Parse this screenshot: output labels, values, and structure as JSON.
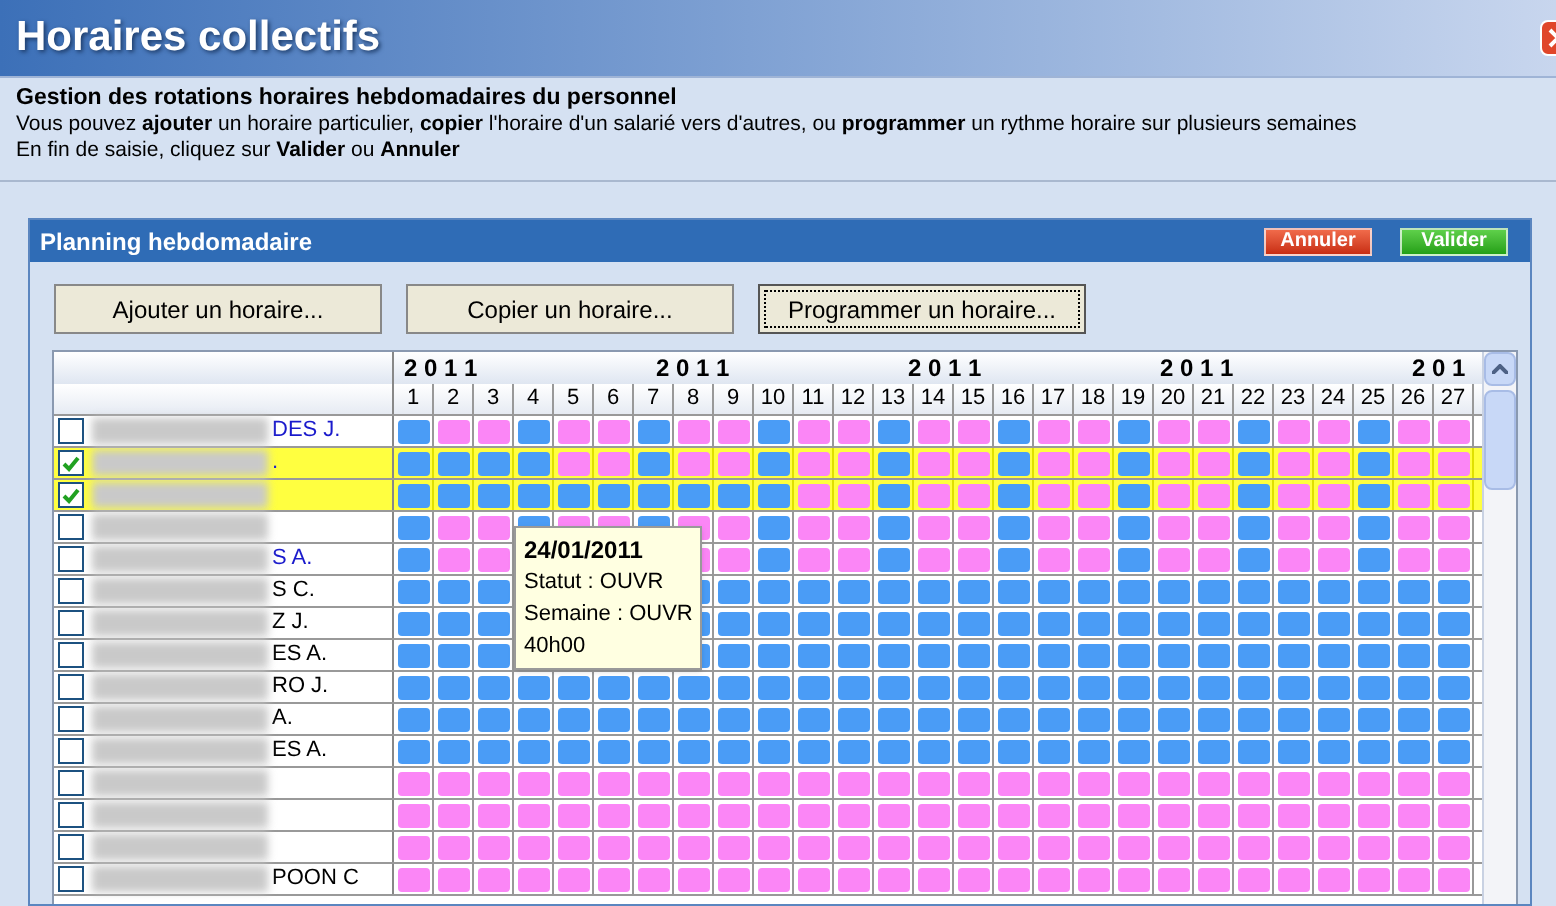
{
  "window": {
    "title": "Horaires collectifs"
  },
  "intro": {
    "heading": "Gestion des rotations horaires hebdomadaires du personnel",
    "lines": [
      "Vous pouvez **ajouter** un horaire particulier, **copier** l'horaire d'un salarié vers d'autres, ou **programmer** un rythme horaire sur plusieurs semaines",
      "En fin de saisie, cliquez sur **Valider** ou **Annuler**"
    ]
  },
  "panel": {
    "title": "Planning hebdomadaire",
    "header_buttons": [
      {
        "label": "Annuler",
        "kind": "cancel"
      },
      {
        "label": "Valider",
        "kind": "ok"
      }
    ],
    "buttons": [
      {
        "label": "Ajouter un horaire...",
        "focused": false
      },
      {
        "label": "Copier un horaire...",
        "focused": false
      },
      {
        "label": "Programmer un horaire...",
        "focused": true
      }
    ]
  },
  "grid": {
    "years": [
      "2 0 1 1",
      "2 0 1 1",
      "2 0 1 1",
      "2 0 1 1",
      "2 0 1"
    ],
    "weeks": [
      "1",
      "2",
      "3",
      "4",
      "5",
      "6",
      "7",
      "8",
      "9",
      "10",
      "11",
      "12",
      "13",
      "14",
      "15",
      "16",
      "17",
      "18",
      "19",
      "20",
      "21",
      "22",
      "23",
      "24",
      "25",
      "26",
      "27"
    ],
    "rows": [
      {
        "name": "DES J.",
        "checked": false,
        "highlighted": false,
        "linked": true,
        "cells": [
          {
            "color": "#4a9cf6"
          },
          {
            "color": "#fb86f6"
          },
          {
            "color": "#fb86f6"
          },
          {
            "color": "#4a9cf6"
          },
          {
            "color": "#fb86f6"
          },
          {
            "color": "#fb86f6"
          },
          {
            "color": "#4a9cf6"
          },
          {
            "color": "#fb86f6"
          },
          {
            "color": "#fb86f6"
          },
          {
            "color": "#4a9cf6"
          },
          {
            "color": "#fb86f6"
          },
          {
            "color": "#fb86f6"
          },
          {
            "color": "#4a9cf6"
          },
          {
            "color": "#fb86f6"
          },
          {
            "color": "#fb86f6"
          },
          {
            "color": "#4a9cf6"
          },
          {
            "color": "#fb86f6"
          },
          {
            "color": "#fb86f6"
          },
          {
            "color": "#4a9cf6"
          },
          {
            "color": "#fb86f6"
          },
          {
            "color": "#fb86f6"
          },
          {
            "color": "#4a9cf6"
          },
          {
            "color": "#fb86f6"
          },
          {
            "color": "#fb86f6"
          },
          {
            "color": "#4a9cf6"
          },
          {
            "color": "#fb86f6"
          },
          {
            "color": "#fb86f6"
          }
        ]
      },
      {
        "name": ".",
        "checked": true,
        "highlighted": true,
        "linked": true,
        "cells": [
          {
            "color": "#4a9cf6"
          },
          {
            "color": "#4a9cf6"
          },
          {
            "color": "#4a9cf6"
          },
          {
            "color": "#4a9cf6"
          },
          {
            "color": "#fb86f6"
          },
          {
            "color": "#fb86f6"
          },
          {
            "color": "#4a9cf6"
          },
          {
            "color": "#fb86f6"
          },
          {
            "color": "#fb86f6"
          },
          {
            "color": "#4a9cf6"
          },
          {
            "color": "#fb86f6"
          },
          {
            "color": "#fb86f6"
          },
          {
            "color": "#4a9cf6"
          },
          {
            "color": "#fb86f6"
          },
          {
            "color": "#fb86f6"
          },
          {
            "color": "#4a9cf6"
          },
          {
            "color": "#fb86f6"
          },
          {
            "color": "#fb86f6"
          },
          {
            "color": "#4a9cf6"
          },
          {
            "color": "#fb86f6"
          },
          {
            "color": "#fb86f6"
          },
          {
            "color": "#4a9cf6"
          },
          {
            "color": "#fb86f6"
          },
          {
            "color": "#fb86f6"
          },
          {
            "color": "#4a9cf6"
          },
          {
            "color": "#fb86f6"
          },
          {
            "color": "#fb86f6"
          }
        ]
      },
      {
        "checked": true,
        "highlighted": true,
        "cells": [
          {
            "color": "#4a9cf6"
          },
          {
            "color": "#4a9cf6"
          },
          {
            "color": "#4a9cf6"
          },
          {
            "color": "#4a9cf6"
          },
          {
            "color": "#4a9cf6"
          },
          {
            "color": "#4a9cf6"
          },
          {
            "color": "#4a9cf6"
          },
          {
            "color": "#4a9cf6"
          },
          {
            "color": "#4a9cf6"
          },
          {
            "color": "#4a9cf6"
          },
          {
            "color": "#fb86f6"
          },
          {
            "color": "#fb86f6"
          },
          {
            "color": "#4a9cf6"
          },
          {
            "color": "#fb86f6"
          },
          {
            "color": "#fb86f6"
          },
          {
            "color": "#4a9cf6"
          },
          {
            "color": "#fb86f6"
          },
          {
            "color": "#fb86f6"
          },
          {
            "color": "#4a9cf6"
          },
          {
            "color": "#fb86f6"
          },
          {
            "color": "#fb86f6"
          },
          {
            "color": "#4a9cf6"
          },
          {
            "color": "#fb86f6"
          },
          {
            "color": "#fb86f6"
          },
          {
            "color": "#4a9cf6"
          },
          {
            "color": "#fb86f6"
          },
          {
            "color": "#fb86f6"
          }
        ]
      },
      {
        "checked": false,
        "highlighted": false,
        "cells": [
          {
            "color": "#4a9cf6"
          },
          {
            "color": "#fb86f6"
          },
          {
            "color": "#fb86f6"
          },
          {
            "color": "#4a9cf6"
          },
          {
            "color": "#fb86f6"
          },
          {
            "color": "#fb86f6"
          },
          {
            "color": "#4a9cf6"
          },
          {
            "color": "#fb86f6"
          },
          {
            "color": "#fb86f6"
          },
          {
            "color": "#4a9cf6"
          },
          {
            "color": "#fb86f6"
          },
          {
            "color": "#fb86f6"
          },
          {
            "color": "#4a9cf6"
          },
          {
            "color": "#fb86f6"
          },
          {
            "color": "#fb86f6"
          },
          {
            "color": "#4a9cf6"
          },
          {
            "color": "#fb86f6"
          },
          {
            "color": "#fb86f6"
          },
          {
            "color": "#4a9cf6"
          },
          {
            "color": "#fb86f6"
          },
          {
            "color": "#fb86f6"
          },
          {
            "color": "#4a9cf6"
          },
          {
            "color": "#fb86f6"
          },
          {
            "color": "#fb86f6"
          },
          {
            "color": "#4a9cf6"
          },
          {
            "color": "#fb86f6"
          },
          {
            "color": "#fb86f6"
          }
        ]
      },
      {
        "name": "S A.",
        "checked": false,
        "highlighted": false,
        "linked": true,
        "cells": [
          {
            "color": "#4a9cf6"
          },
          {
            "color": "#fb86f6"
          },
          {
            "color": "#fb86f6"
          },
          null,
          null,
          null,
          null,
          {
            "color": "#fb86f6"
          },
          {
            "color": "#fb86f6"
          },
          {
            "color": "#4a9cf6"
          },
          {
            "color": "#fb86f6"
          },
          {
            "color": "#fb86f6"
          },
          {
            "color": "#4a9cf6"
          },
          {
            "color": "#fb86f6"
          },
          {
            "color": "#fb86f6"
          },
          {
            "color": "#4a9cf6"
          },
          {
            "color": "#fb86f6"
          },
          {
            "color": "#fb86f6"
          },
          {
            "color": "#4a9cf6"
          },
          {
            "color": "#fb86f6"
          },
          {
            "color": "#fb86f6"
          },
          {
            "color": "#4a9cf6"
          },
          {
            "color": "#fb86f6"
          },
          {
            "color": "#fb86f6"
          },
          {
            "color": "#4a9cf6"
          },
          {
            "color": "#fb86f6"
          },
          {
            "color": "#fb86f6"
          }
        ]
      },
      {
        "name": "S C.",
        "checked": false,
        "highlighted": false,
        "linked": false,
        "cells": [
          {
            "color": "#4a9cf6"
          },
          {
            "color": "#4a9cf6"
          },
          {
            "color": "#4a9cf6"
          },
          null,
          null,
          null,
          null,
          {
            "color": "#4a9cf6"
          },
          {
            "color": "#4a9cf6"
          },
          {
            "color": "#4a9cf6"
          },
          {
            "color": "#4a9cf6"
          },
          {
            "color": "#4a9cf6"
          },
          {
            "color": "#4a9cf6"
          },
          {
            "color": "#4a9cf6"
          },
          {
            "color": "#4a9cf6"
          },
          {
            "color": "#4a9cf6"
          },
          {
            "color": "#4a9cf6"
          },
          {
            "color": "#4a9cf6"
          },
          {
            "color": "#4a9cf6"
          },
          {
            "color": "#4a9cf6"
          },
          {
            "color": "#4a9cf6"
          },
          {
            "color": "#4a9cf6"
          },
          {
            "color": "#4a9cf6"
          },
          {
            "color": "#4a9cf6"
          },
          {
            "color": "#4a9cf6"
          },
          {
            "color": "#4a9cf6"
          },
          {
            "color": "#4a9cf6"
          }
        ]
      },
      {
        "name": "Z J.",
        "checked": false,
        "highlighted": false,
        "linked": false,
        "cells": [
          {
            "color": "#4a9cf6"
          },
          {
            "color": "#4a9cf6"
          },
          {
            "color": "#4a9cf6"
          },
          null,
          null,
          null,
          null,
          {
            "color": "#4a9cf6"
          },
          {
            "color": "#4a9cf6"
          },
          {
            "color": "#4a9cf6"
          },
          {
            "color": "#4a9cf6"
          },
          {
            "color": "#4a9cf6"
          },
          {
            "color": "#4a9cf6"
          },
          {
            "color": "#4a9cf6"
          },
          {
            "color": "#4a9cf6"
          },
          {
            "color": "#4a9cf6"
          },
          {
            "color": "#4a9cf6"
          },
          {
            "color": "#4a9cf6"
          },
          {
            "color": "#4a9cf6"
          },
          {
            "color": "#4a9cf6"
          },
          {
            "color": "#4a9cf6"
          },
          {
            "color": "#4a9cf6"
          },
          {
            "color": "#4a9cf6"
          },
          {
            "color": "#4a9cf6"
          },
          {
            "color": "#4a9cf6"
          },
          {
            "color": "#4a9cf6"
          },
          {
            "color": "#4a9cf6"
          }
        ]
      },
      {
        "name": "ES A.",
        "checked": false,
        "highlighted": false,
        "linked": false,
        "cells": [
          {
            "color": "#4a9cf6"
          },
          {
            "color": "#4a9cf6"
          },
          {
            "color": "#4a9cf6"
          },
          null,
          null,
          null,
          null,
          {
            "color": "#4a9cf6"
          },
          {
            "color": "#4a9cf6"
          },
          {
            "color": "#4a9cf6"
          },
          {
            "color": "#4a9cf6"
          },
          {
            "color": "#4a9cf6"
          },
          {
            "color": "#4a9cf6"
          },
          {
            "color": "#4a9cf6"
          },
          {
            "color": "#4a9cf6"
          },
          {
            "color": "#4a9cf6"
          },
          {
            "color": "#4a9cf6"
          },
          {
            "color": "#4a9cf6"
          },
          {
            "color": "#4a9cf6"
          },
          {
            "color": "#4a9cf6"
          },
          {
            "color": "#4a9cf6"
          },
          {
            "color": "#4a9cf6"
          },
          {
            "color": "#4a9cf6"
          },
          {
            "color": "#4a9cf6"
          },
          {
            "color": "#4a9cf6"
          },
          {
            "color": "#4a9cf6"
          },
          {
            "color": "#4a9cf6"
          }
        ]
      },
      {
        "name": "RO J.",
        "checked": false,
        "highlighted": false,
        "linked": false,
        "cells": [
          {
            "color": "#4a9cf6"
          },
          {
            "color": "#4a9cf6"
          },
          {
            "color": "#4a9cf6"
          },
          {
            "color": "#4a9cf6"
          },
          {
            "color": "#4a9cf6"
          },
          {
            "color": "#4a9cf6"
          },
          {
            "color": "#4a9cf6"
          },
          {
            "color": "#4a9cf6"
          },
          {
            "color": "#4a9cf6"
          },
          {
            "color": "#4a9cf6"
          },
          {
            "color": "#4a9cf6"
          },
          {
            "color": "#4a9cf6"
          },
          {
            "color": "#4a9cf6"
          },
          {
            "color": "#4a9cf6"
          },
          {
            "color": "#4a9cf6"
          },
          {
            "color": "#4a9cf6"
          },
          {
            "color": "#4a9cf6"
          },
          {
            "color": "#4a9cf6"
          },
          {
            "color": "#4a9cf6"
          },
          {
            "color": "#4a9cf6"
          },
          {
            "color": "#4a9cf6"
          },
          {
            "color": "#4a9cf6"
          },
          {
            "color": "#4a9cf6"
          },
          {
            "color": "#4a9cf6"
          },
          {
            "color": "#4a9cf6"
          },
          {
            "color": "#4a9cf6"
          },
          {
            "color": "#4a9cf6"
          }
        ]
      },
      {
        "name": "A.",
        "checked": false,
        "highlighted": false,
        "linked": false,
        "cells": [
          {
            "color": "#4a9cf6"
          },
          {
            "color": "#4a9cf6"
          },
          {
            "color": "#4a9cf6"
          },
          {
            "color": "#4a9cf6"
          },
          {
            "color": "#4a9cf6"
          },
          {
            "color": "#4a9cf6"
          },
          {
            "color": "#4a9cf6"
          },
          {
            "color": "#4a9cf6"
          },
          {
            "color": "#4a9cf6"
          },
          {
            "color": "#4a9cf6"
          },
          {
            "color": "#4a9cf6"
          },
          {
            "color": "#4a9cf6"
          },
          {
            "color": "#4a9cf6"
          },
          {
            "color": "#4a9cf6"
          },
          {
            "color": "#4a9cf6"
          },
          {
            "color": "#4a9cf6"
          },
          {
            "color": "#4a9cf6"
          },
          {
            "color": "#4a9cf6"
          },
          {
            "color": "#4a9cf6"
          },
          {
            "color": "#4a9cf6"
          },
          {
            "color": "#4a9cf6"
          },
          {
            "color": "#4a9cf6"
          },
          {
            "color": "#4a9cf6"
          },
          {
            "color": "#4a9cf6"
          },
          {
            "color": "#4a9cf6"
          },
          {
            "color": "#4a9cf6"
          },
          {
            "color": "#4a9cf6"
          }
        ]
      },
      {
        "name": "ES A.",
        "checked": false,
        "highlighted": false,
        "linked": false,
        "cells": [
          {
            "color": "#4a9cf6"
          },
          {
            "color": "#4a9cf6"
          },
          {
            "color": "#4a9cf6"
          },
          {
            "color": "#4a9cf6"
          },
          {
            "color": "#4a9cf6"
          },
          {
            "color": "#4a9cf6"
          },
          {
            "color": "#4a9cf6"
          },
          {
            "color": "#4a9cf6"
          },
          {
            "color": "#4a9cf6"
          },
          {
            "color": "#4a9cf6"
          },
          {
            "color": "#4a9cf6"
          },
          {
            "color": "#4a9cf6"
          },
          {
            "color": "#4a9cf6"
          },
          {
            "color": "#4a9cf6"
          },
          {
            "color": "#4a9cf6"
          },
          {
            "color": "#4a9cf6"
          },
          {
            "color": "#4a9cf6"
          },
          {
            "color": "#4a9cf6"
          },
          {
            "color": "#4a9cf6"
          },
          {
            "color": "#4a9cf6"
          },
          {
            "color": "#4a9cf6"
          },
          {
            "color": "#4a9cf6"
          },
          {
            "color": "#4a9cf6"
          },
          {
            "color": "#4a9cf6"
          },
          {
            "color": "#4a9cf6"
          },
          {
            "color": "#4a9cf6"
          },
          {
            "color": "#4a9cf6"
          }
        ]
      },
      {
        "checked": false,
        "highlighted": false,
        "cells": [
          {
            "color": "#fb86f6"
          },
          {
            "color": "#fb86f6"
          },
          {
            "color": "#fb86f6"
          },
          {
            "color": "#fb86f6"
          },
          {
            "color": "#fb86f6"
          },
          {
            "color": "#fb86f6"
          },
          {
            "color": "#fb86f6"
          },
          {
            "color": "#fb86f6"
          },
          {
            "color": "#fb86f6"
          },
          {
            "color": "#fb86f6"
          },
          {
            "color": "#fb86f6"
          },
          {
            "color": "#fb86f6"
          },
          {
            "color": "#fb86f6"
          },
          {
            "color": "#fb86f6"
          },
          {
            "color": "#fb86f6"
          },
          {
            "color": "#fb86f6"
          },
          {
            "color": "#fb86f6"
          },
          {
            "color": "#fb86f6"
          },
          {
            "color": "#fb86f6"
          },
          {
            "color": "#fb86f6"
          },
          {
            "color": "#fb86f6"
          },
          {
            "color": "#fb86f6"
          },
          {
            "color": "#fb86f6"
          },
          {
            "color": "#fb86f6"
          },
          {
            "color": "#fb86f6"
          },
          {
            "color": "#fb86f6"
          },
          {
            "color": "#fb86f6"
          }
        ]
      },
      {
        "checked": false,
        "highlighted": false,
        "cells": [
          {
            "color": "#fb86f6"
          },
          {
            "color": "#fb86f6"
          },
          {
            "color": "#fb86f6"
          },
          {
            "color": "#fb86f6"
          },
          {
            "color": "#fb86f6"
          },
          {
            "color": "#fb86f6"
          },
          {
            "color": "#fb86f6"
          },
          {
            "color": "#fb86f6"
          },
          {
            "color": "#fb86f6"
          },
          {
            "color": "#fb86f6"
          },
          {
            "color": "#fb86f6"
          },
          {
            "color": "#fb86f6"
          },
          {
            "color": "#fb86f6"
          },
          {
            "color": "#fb86f6"
          },
          {
            "color": "#fb86f6"
          },
          {
            "color": "#fb86f6"
          },
          {
            "color": "#fb86f6"
          },
          {
            "color": "#fb86f6"
          },
          {
            "color": "#fb86f6"
          },
          {
            "color": "#fb86f6"
          },
          {
            "color": "#fb86f6"
          },
          {
            "color": "#fb86f6"
          },
          {
            "color": "#fb86f6"
          },
          {
            "color": "#fb86f6"
          },
          {
            "color": "#fb86f6"
          },
          {
            "color": "#fb86f6"
          },
          {
            "color": "#fb86f6"
          }
        ]
      },
      {
        "checked": false,
        "highlighted": false,
        "cells": [
          {
            "color": "#fb86f6"
          },
          {
            "color": "#fb86f6"
          },
          {
            "color": "#fb86f6"
          },
          {
            "color": "#fb86f6"
          },
          {
            "color": "#fb86f6"
          },
          {
            "color": "#fb86f6"
          },
          {
            "color": "#fb86f6"
          },
          {
            "color": "#fb86f6"
          },
          {
            "color": "#fb86f6"
          },
          {
            "color": "#fb86f6"
          },
          {
            "color": "#fb86f6"
          },
          {
            "color": "#fb86f6"
          },
          {
            "color": "#fb86f6"
          },
          {
            "color": "#fb86f6"
          },
          {
            "color": "#fb86f6"
          },
          {
            "color": "#fb86f6"
          },
          {
            "color": "#fb86f6"
          },
          {
            "color": "#fb86f6"
          },
          {
            "color": "#fb86f6"
          },
          {
            "color": "#fb86f6"
          },
          {
            "color": "#fb86f6"
          },
          {
            "color": "#fb86f6"
          },
          {
            "color": "#fb86f6"
          },
          {
            "color": "#fb86f6"
          },
          {
            "color": "#fb86f6"
          },
          {
            "color": "#fb86f6"
          },
          {
            "color": "#fb86f6"
          }
        ]
      },
      {
        "name": "POON C",
        "checked": false,
        "highlighted": false,
        "linked": false,
        "cells": [
          {
            "color": "#fb86f6"
          },
          {
            "color": "#fb86f6"
          },
          {
            "color": "#fb86f6"
          },
          {
            "color": "#fb86f6"
          },
          {
            "color": "#fb86f6"
          },
          {
            "color": "#fb86f6"
          },
          {
            "color": "#fb86f6"
          },
          {
            "color": "#fb86f6"
          },
          {
            "color": "#fb86f6"
          },
          {
            "color": "#fb86f6"
          },
          {
            "color": "#fb86f6"
          },
          {
            "color": "#fb86f6"
          },
          {
            "color": "#fb86f6"
          },
          {
            "color": "#fb86f6"
          },
          {
            "color": "#fb86f6"
          },
          {
            "color": "#fb86f6"
          },
          {
            "color": "#fb86f6"
          },
          {
            "color": "#fb86f6"
          },
          {
            "color": "#fb86f6"
          },
          {
            "color": "#fb86f6"
          },
          {
            "color": "#fb86f6"
          },
          {
            "color": "#fb86f6"
          },
          {
            "color": "#fb86f6"
          },
          {
            "color": "#fb86f6"
          },
          {
            "color": "#fb86f6"
          },
          {
            "color": "#fb86f6"
          },
          {
            "color": "#fb86f6"
          }
        ]
      }
    ]
  },
  "tooltip": {
    "date": "24/01/2011",
    "lines": [
      "Statut : OUVR",
      "Semaine : OUVR",
      "40h00"
    ]
  }
}
